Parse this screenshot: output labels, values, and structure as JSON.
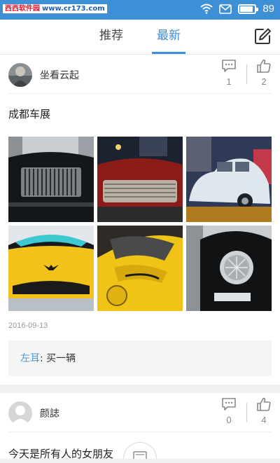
{
  "status_bar": {
    "watermark_name": "西西软件园",
    "watermark_url": "www.cr173.com",
    "battery_level": "89",
    "battery_fraction": 0.89
  },
  "header": {
    "tabs": [
      {
        "label": "推荐",
        "active": false
      },
      {
        "label": "最新",
        "active": true
      }
    ],
    "compose_icon": "edit-icon",
    "accent_color": "#3d8fd6"
  },
  "posts": [
    {
      "username": "坐看云起",
      "comment_count": "1",
      "like_count": "2",
      "text": "成都车展",
      "photos": [
        "black-limousine-grille",
        "red-classic-car",
        "white-vintage-car",
        "yellow-sports-car-front",
        "yellow-sports-car-side",
        "black-car-headlight"
      ],
      "date": "2016-09-13",
      "comments": [
        {
          "author": "左耳",
          "separator": ": ",
          "text": "买一辆"
        }
      ]
    },
    {
      "username": "颜誌",
      "comment_count": "0",
      "like_count": "4",
      "text": "今天是所有人的女朋友"
    }
  ]
}
